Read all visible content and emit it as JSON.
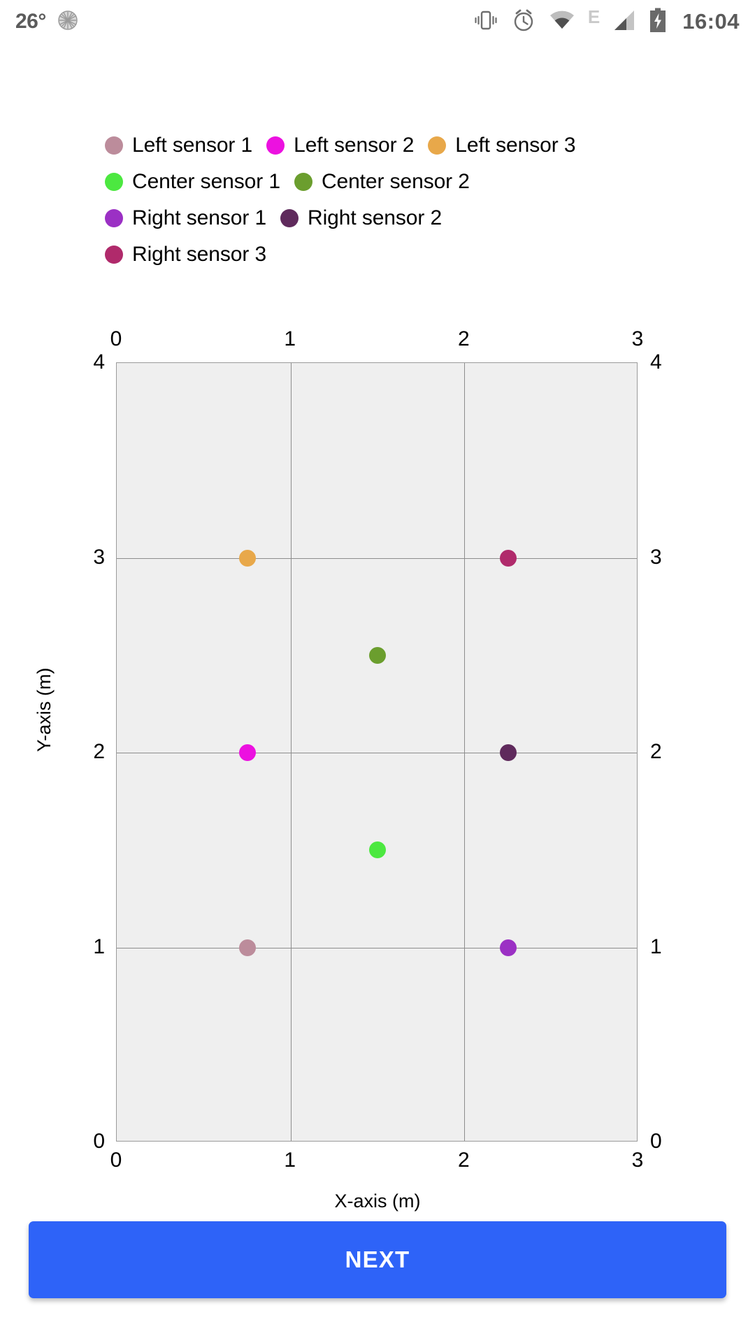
{
  "status_bar": {
    "temperature": "26°",
    "time": "16:04",
    "network_type": "E",
    "icons": [
      "brightness-icon",
      "vibrate-icon",
      "alarm-icon",
      "wifi-icon",
      "edge-network-label",
      "signal-icon",
      "battery-charging-icon"
    ]
  },
  "legend": {
    "rows": [
      [
        {
          "label": "Left sensor 1",
          "color": "#bc8c9b"
        },
        {
          "label": "Left sensor 2",
          "color": "#ec11e0"
        },
        {
          "label": "Left sensor 3",
          "color": "#e8a84a"
        }
      ],
      [
        {
          "label": "Center sensor 1",
          "color": "#4ce840"
        },
        {
          "label": "Center sensor 2",
          "color": "#6b9e2e"
        }
      ],
      [
        {
          "label": "Right sensor 1",
          "color": "#9b30c4"
        },
        {
          "label": "Right sensor 2",
          "color": "#5f2a5c"
        }
      ],
      [
        {
          "label": "Right sensor 3",
          "color": "#b02a6b"
        }
      ]
    ]
  },
  "chart_data": {
    "type": "scatter",
    "title": "",
    "xlabel": "X-axis  (m)",
    "ylabel": "Y-axis (m)",
    "xlim": [
      0,
      3
    ],
    "ylim": [
      0,
      4
    ],
    "xticks": [
      "0",
      "1",
      "2",
      "3"
    ],
    "xtick_values": [
      0,
      1,
      2,
      3
    ],
    "yticks": [
      "0",
      "1",
      "2",
      "3",
      "4"
    ],
    "ytick_values": [
      0,
      1,
      2,
      3,
      4
    ],
    "grid": true,
    "legend_position": "top",
    "plot_background": "#efefef",
    "grid_color": "#8d8d8d",
    "mirrored_axes": true,
    "series": [
      {
        "name": "Left sensor 1",
        "color": "#bc8c9b",
        "x": [
          0.75
        ],
        "y": [
          1.0
        ]
      },
      {
        "name": "Left sensor 2",
        "color": "#ec11e0",
        "x": [
          0.75
        ],
        "y": [
          2.0
        ]
      },
      {
        "name": "Left sensor 3",
        "color": "#e8a84a",
        "x": [
          0.75
        ],
        "y": [
          3.0
        ]
      },
      {
        "name": "Center sensor 1",
        "color": "#4ce840",
        "x": [
          1.5
        ],
        "y": [
          1.5
        ]
      },
      {
        "name": "Center sensor 2",
        "color": "#6b9e2e",
        "x": [
          1.5
        ],
        "y": [
          2.5
        ]
      },
      {
        "name": "Right sensor 1",
        "color": "#9b30c4",
        "x": [
          2.25
        ],
        "y": [
          1.0
        ]
      },
      {
        "name": "Right sensor 2",
        "color": "#5f2a5c",
        "x": [
          2.25
        ],
        "y": [
          2.0
        ]
      },
      {
        "name": "Right sensor 3",
        "color": "#b02a6b",
        "x": [
          2.25
        ],
        "y": [
          3.0
        ]
      }
    ]
  },
  "footer": {
    "next_label": "NEXT"
  },
  "colors": {
    "accent": "#2e63f8",
    "plot_bg": "#efefef"
  }
}
